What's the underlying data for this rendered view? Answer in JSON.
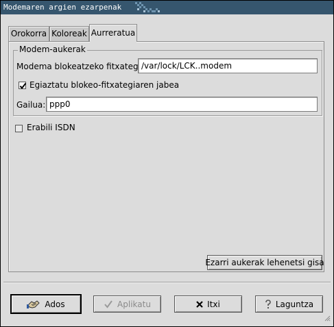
{
  "window": {
    "title": "Modemaren argien ezarpenak"
  },
  "tabs": [
    {
      "label": "Orokorra",
      "active": false
    },
    {
      "label": "Koloreak",
      "active": false
    },
    {
      "label": "Aurreratua",
      "active": true
    }
  ],
  "modem_options": {
    "frame_title": "Modem-aukerak",
    "lockfile_label": "Modema blokeatzeko fitxategia:",
    "lockfile_value": "/var/lock/LCK..modem",
    "verify_owner_label": "Egiaztatu blokeo-fitxategiaren jabea",
    "verify_owner_checked": true,
    "device_label": "Gailua:",
    "device_value": "ppp0"
  },
  "isdn": {
    "label": "Erabili ISDN",
    "checked": false
  },
  "reset_button": "Ezarri aukerak lehenetsi gisa",
  "buttons": {
    "ok": "Ados",
    "apply": "Aplikatu",
    "close": "Itxi",
    "help": "Laguntza"
  },
  "icons": {
    "ok": "handshake-icon",
    "apply": "checkmark-icon",
    "close": "x-icon",
    "help": "question-icon"
  },
  "colors": {
    "titlebar": "#36566e",
    "background": "#dcdcdc"
  }
}
